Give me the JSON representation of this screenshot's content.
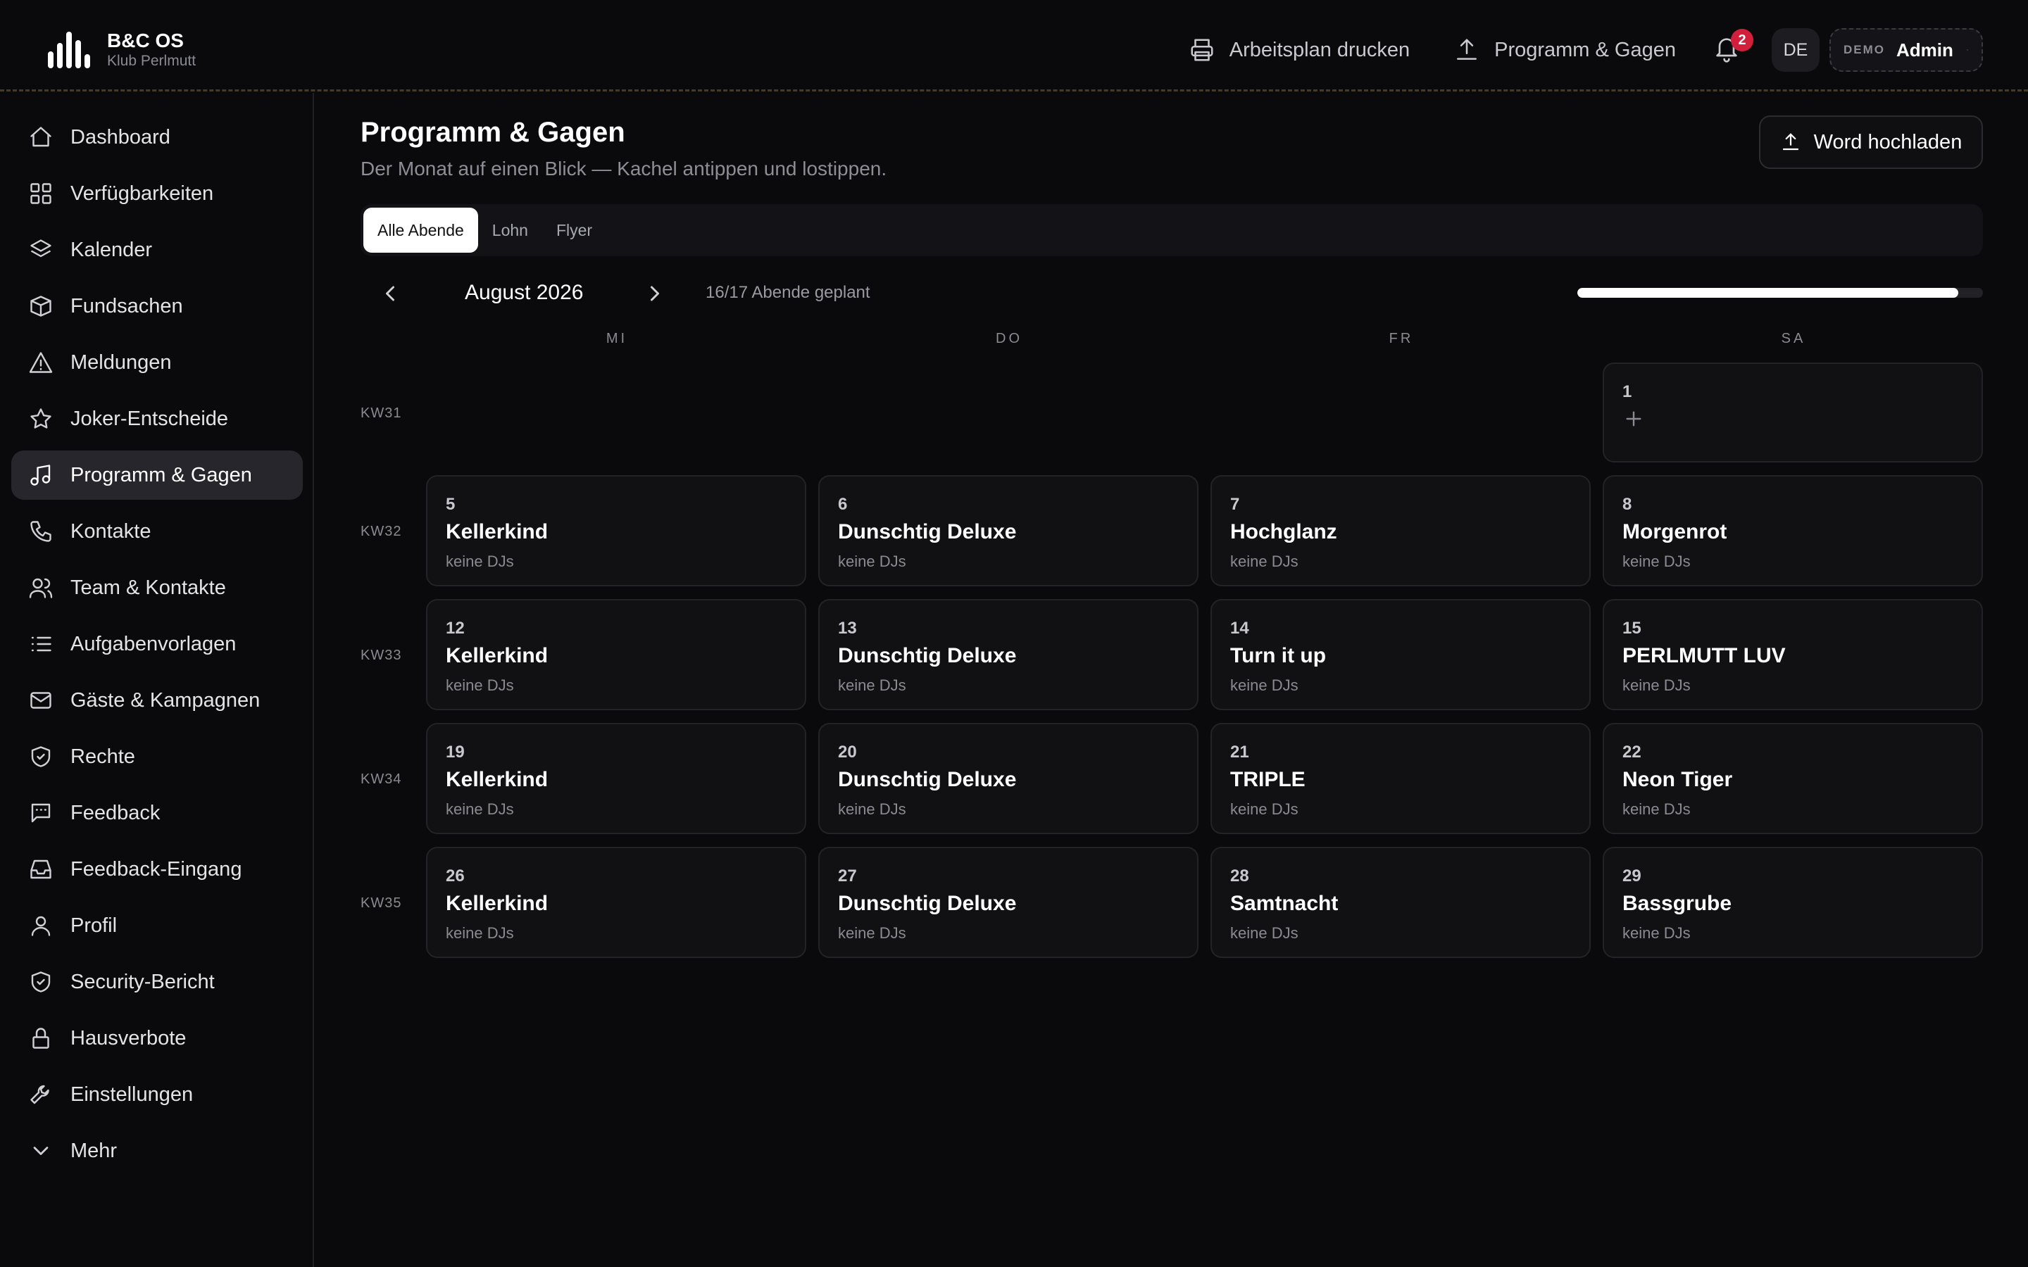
{
  "app": {
    "name": "B&C OS",
    "venue": "Klub Perlmutt"
  },
  "topbar": {
    "print_label": "Arbeitsplan drucken",
    "program_label": "Programm & Gagen",
    "notification_count": "2",
    "language": "DE",
    "user_tag": "DEMO",
    "user_name": "Admin"
  },
  "sidebar": {
    "items": [
      {
        "label": "Dashboard",
        "icon": "home-icon"
      },
      {
        "label": "Verfügbarkeiten",
        "icon": "grid-icon"
      },
      {
        "label": "Kalender",
        "icon": "layers-icon"
      },
      {
        "label": "Fundsachen",
        "icon": "box-icon"
      },
      {
        "label": "Meldungen",
        "icon": "warning-icon"
      },
      {
        "label": "Joker-Entscheide",
        "icon": "star-icon"
      },
      {
        "label": "Programm & Gagen",
        "icon": "music-icon",
        "active": true
      },
      {
        "label": "Kontakte",
        "icon": "phone-icon"
      },
      {
        "label": "Team & Kontakte",
        "icon": "users-icon"
      },
      {
        "label": "Aufgabenvorlagen",
        "icon": "list-icon"
      },
      {
        "label": "Gäste & Kampagnen",
        "icon": "mail-icon"
      },
      {
        "label": "Rechte",
        "icon": "shield-check-icon"
      },
      {
        "label": "Feedback",
        "icon": "message-icon"
      },
      {
        "label": "Feedback-Eingang",
        "icon": "inbox-icon"
      },
      {
        "label": "Profil",
        "icon": "user-icon"
      },
      {
        "label": "Security-Bericht",
        "icon": "shield-check-icon"
      },
      {
        "label": "Hausverbote",
        "icon": "lock-icon"
      },
      {
        "label": "Einstellungen",
        "icon": "wrench-icon"
      },
      {
        "label": "Mehr",
        "icon": "chevron-down-icon"
      }
    ]
  },
  "main": {
    "title": "Programm & Gagen",
    "subtitle": "Der Monat auf einen Blick — Kachel antippen und lostippen.",
    "upload_label": "Word hochladen",
    "tabs": [
      {
        "label": "Alle Abende",
        "active": true
      },
      {
        "label": "Lohn"
      },
      {
        "label": "Flyer"
      }
    ],
    "month": "August 2026",
    "planned": "16/17 Abende geplant",
    "planned_fraction": 0.94,
    "weekdays": [
      "MI",
      "DO",
      "FR",
      "SA"
    ],
    "weeks": [
      {
        "kw": "KW31",
        "days": [
          null,
          null,
          null,
          {
            "day": "1",
            "empty": true
          }
        ]
      },
      {
        "kw": "KW32",
        "days": [
          {
            "day": "5",
            "event": "Kellerkind",
            "djs": "keine DJs"
          },
          {
            "day": "6",
            "event": "Dunschtig Deluxe",
            "djs": "keine DJs"
          },
          {
            "day": "7",
            "event": "Hochglanz",
            "djs": "keine DJs"
          },
          {
            "day": "8",
            "event": "Morgenrot",
            "djs": "keine DJs"
          }
        ]
      },
      {
        "kw": "KW33",
        "days": [
          {
            "day": "12",
            "event": "Kellerkind",
            "djs": "keine DJs"
          },
          {
            "day": "13",
            "event": "Dunschtig Deluxe",
            "djs": "keine DJs"
          },
          {
            "day": "14",
            "event": "Turn it up",
            "djs": "keine DJs"
          },
          {
            "day": "15",
            "event": "PERLMUTT LUV",
            "djs": "keine DJs"
          }
        ]
      },
      {
        "kw": "KW34",
        "days": [
          {
            "day": "19",
            "event": "Kellerkind",
            "djs": "keine DJs"
          },
          {
            "day": "20",
            "event": "Dunschtig Deluxe",
            "djs": "keine DJs"
          },
          {
            "day": "21",
            "event": "TRIPLE",
            "djs": "keine DJs"
          },
          {
            "day": "22",
            "event": "Neon Tiger",
            "djs": "keine DJs"
          }
        ]
      },
      {
        "kw": "KW35",
        "days": [
          {
            "day": "26",
            "event": "Kellerkind",
            "djs": "keine DJs"
          },
          {
            "day": "27",
            "event": "Dunschtig Deluxe",
            "djs": "keine DJs"
          },
          {
            "day": "28",
            "event": "Samtnacht",
            "djs": "keine DJs"
          },
          {
            "day": "29",
            "event": "Bassgrube",
            "djs": "keine DJs"
          }
        ]
      }
    ]
  },
  "colors": {
    "background": "#0a0a0c",
    "accent_badge": "#d21f3c",
    "active_nav": "#26262c"
  }
}
